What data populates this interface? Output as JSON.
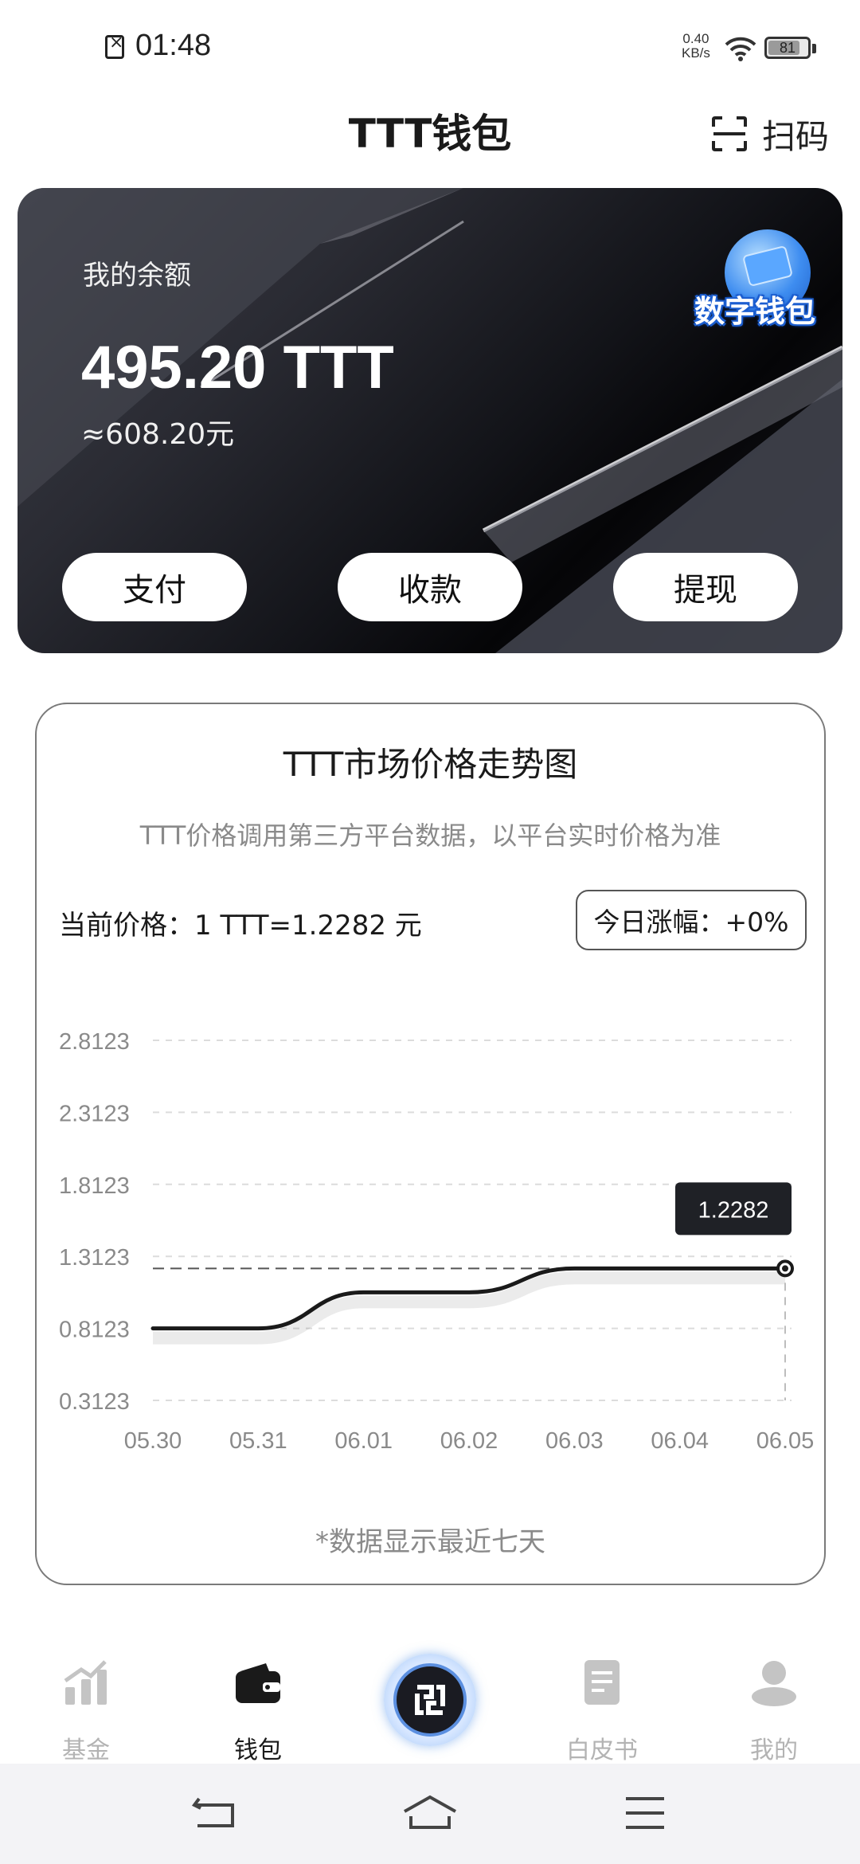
{
  "status_bar": {
    "time": "01:48",
    "net_speed_value": "0.40",
    "net_speed_unit": "KB/s",
    "battery_level": "81",
    "battery_fraction": 0.81
  },
  "header": {
    "title": "TTT钱包",
    "scan_label": "扫码"
  },
  "balance_card": {
    "label": "我的余额",
    "amount": "495.20 TTT",
    "cny_equivalent": "≈608.20元",
    "badge_label": "数字钱包",
    "buttons": {
      "pay": "支付",
      "receive": "收款",
      "withdraw": "提现"
    }
  },
  "chart_card": {
    "title": "TTT市场价格走势图",
    "subtitle": "TTT价格调用第三方平台数据，以平台实时价格为准",
    "current_price": "当前价格：1 TTT=1.2282 元",
    "daily_change": "今日涨幅：+0%",
    "note": "*数据显示最近七天"
  },
  "chart_data": {
    "type": "line",
    "title": "TTT市场价格走势图",
    "x": [
      "05.30",
      "05.31",
      "06.01",
      "06.02",
      "06.03",
      "06.04",
      "06.05"
    ],
    "series": [
      {
        "values": [
          0.8123,
          0.8123,
          1.0623,
          1.0623,
          1.2282,
          1.2282,
          1.2282
        ]
      }
    ],
    "y_ticks": [
      "2.8123",
      "2.3123",
      "1.8123",
      "1.3123",
      "0.8123",
      "0.3123"
    ],
    "ylim": [
      0.3123,
      2.8123
    ],
    "tooltip": "1.2282",
    "reference_value": 1.2282,
    "grid": true,
    "line_color": "#1a1a1a"
  },
  "bottom_nav": {
    "items": [
      {
        "label": "基金",
        "icon": "chart-bars-icon",
        "active": false
      },
      {
        "label": "钱包",
        "icon": "wallet-icon",
        "active": true
      },
      {
        "label": "",
        "icon": "app-logo-icon",
        "active": false
      },
      {
        "label": "白皮书",
        "icon": "document-icon",
        "active": false
      },
      {
        "label": "我的",
        "icon": "user-icon",
        "active": false
      }
    ]
  },
  "system_nav": {
    "back_icon": "back-icon",
    "home_icon": "home-icon",
    "menu_icon": "menu-icon"
  }
}
